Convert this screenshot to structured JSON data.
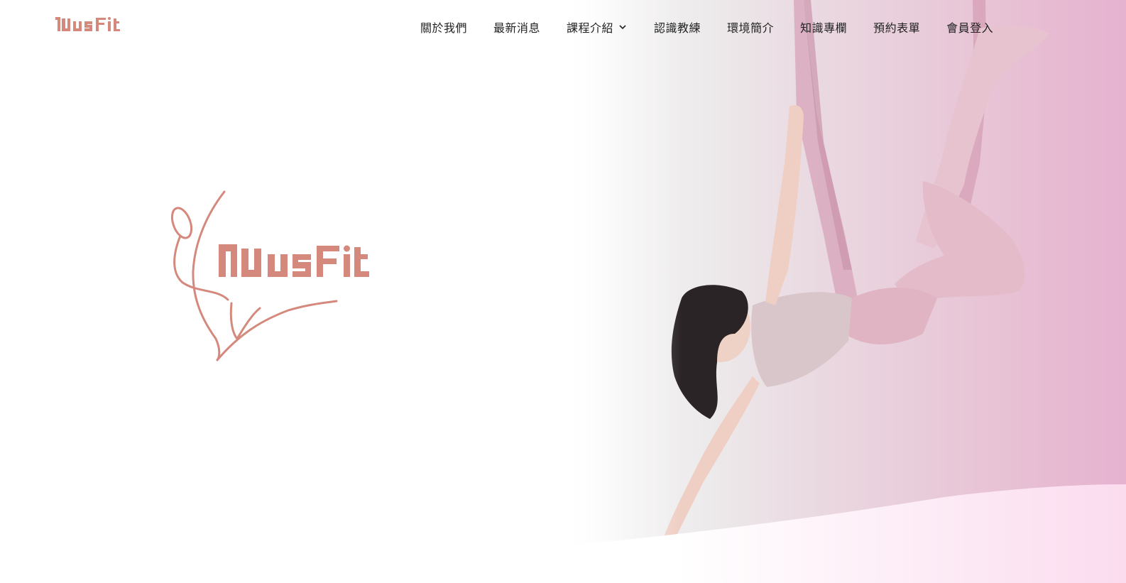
{
  "brand": {
    "name": "MusFit",
    "color": "#d4897c"
  },
  "nav": {
    "items": [
      {
        "label": "關於我們",
        "dropdown": false
      },
      {
        "label": "最新消息",
        "dropdown": false
      },
      {
        "label": "課程介紹",
        "dropdown": true
      },
      {
        "label": "認識教練",
        "dropdown": false
      },
      {
        "label": "環境簡介",
        "dropdown": false
      },
      {
        "label": "知識專欄",
        "dropdown": false
      },
      {
        "label": "預約表單",
        "dropdown": false
      },
      {
        "label": "會員登入",
        "dropdown": false
      }
    ],
    "text_color": "#222222",
    "dropdown_icon": "chevron-down-icon"
  },
  "hero": {
    "image": "aerial-yoga-performer",
    "accent_pink": "#e6b2cf",
    "fabric_color": "#d9a9bd"
  }
}
